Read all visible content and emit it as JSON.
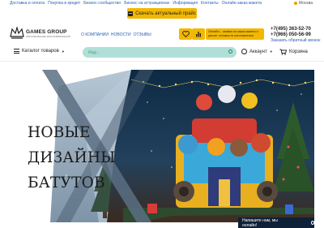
{
  "topnav": {
    "items": [
      "Доставка и оплата",
      "Покупка в кредит",
      "Бизнес-сообщество",
      "Бизнес на аттракционах",
      "Информация",
      "Контакты",
      "Онлайн-заказ макета"
    ],
    "city": "Москва"
  },
  "price_button": {
    "label": "Скачать актуальный прайс"
  },
  "logo": {
    "title": "GAMES GROUP",
    "subtitle": "ОБОРУДОВАНИЕ ДЛЯ РАЗВЛЕЧЕНИЙ"
  },
  "midnav": {
    "items": [
      "О КОМПАНИИ",
      "НОВОСТИ",
      "ОТЗЫВЫ"
    ]
  },
  "online": {
    "text": "Онлайн – заявка на заказ макета и расчет стоимости изготовления"
  },
  "phones": {
    "phone1": "+7(495) 363-52-70",
    "phone2": "+7(966) 050-56-99",
    "callback": "Заказать обратный звонок"
  },
  "catalog": {
    "label": "Каталог товаров"
  },
  "search": {
    "placeholder": "Ищу..."
  },
  "account": {
    "label": "Аккаунт"
  },
  "cart": {
    "label": "Корзина"
  },
  "banner": {
    "line1": "НОВЫЕ",
    "line2": "ДИЗАЙНЫ",
    "line3": "БАТУТОВ"
  },
  "chat": {
    "label": "Напишите нам, мы онлайн!"
  },
  "colors": {
    "accent": "#f2b800",
    "link": "#2a63b8",
    "search_bg": "#aee0d8",
    "chat_bg": "#0f2138"
  }
}
